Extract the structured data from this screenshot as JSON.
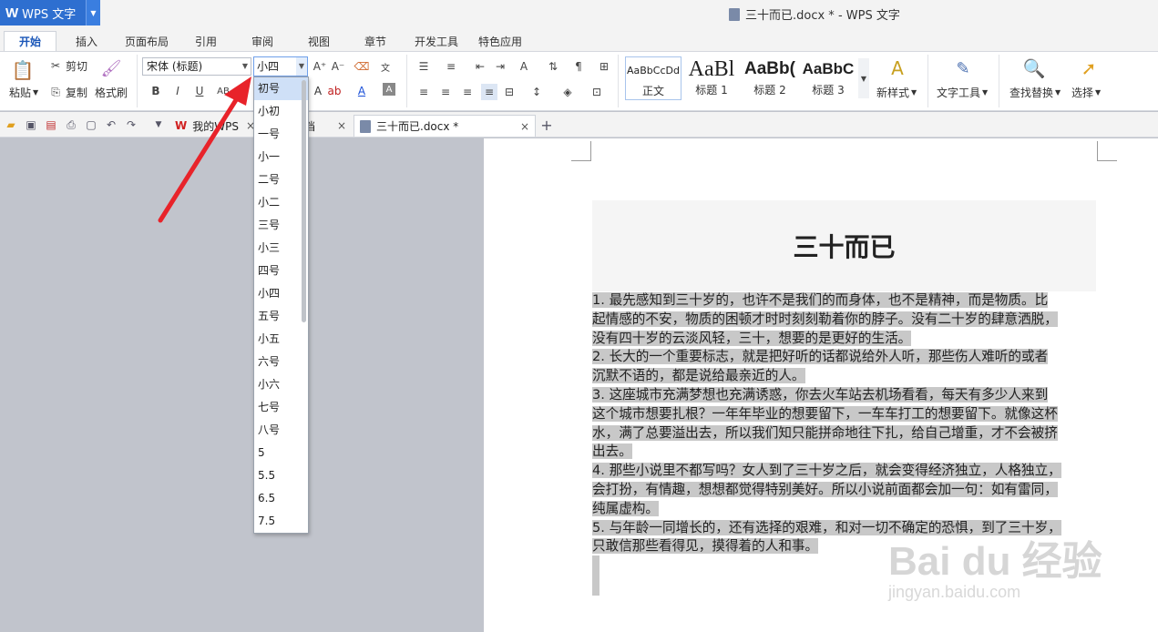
{
  "app": {
    "name": "WPS 文字",
    "window_title": "三十而已.docx * - WPS 文字"
  },
  "ribbon_tabs": [
    "开始",
    "插入",
    "页面布局",
    "引用",
    "审阅",
    "视图",
    "章节",
    "开发工具",
    "特色应用"
  ],
  "ribbon": {
    "paste": "粘贴",
    "cut": "剪切",
    "copy": "复制",
    "format_painter": "格式刷",
    "font_name": "宋体 (标题)",
    "font_size": "小四",
    "styles": [
      {
        "preview": "AaBbCcDd",
        "name": "正文"
      },
      {
        "preview": "AaBl",
        "name": "标题 1"
      },
      {
        "preview": "AaBb(",
        "name": "标题 2"
      },
      {
        "preview": "AaBbC",
        "name": "标题 3"
      }
    ],
    "new_style": "新样式",
    "text_tools": "文字工具",
    "find_replace": "查找替换",
    "select": "选择"
  },
  "doc_tabs": [
    {
      "label": "我的WPS"
    },
    {
      "label": "档"
    },
    {
      "label": "三十而已.docx *"
    }
  ],
  "font_size_options": [
    "初号",
    "小初",
    "一号",
    "小一",
    "二号",
    "小二",
    "三号",
    "小三",
    "四号",
    "小四",
    "五号",
    "小五",
    "六号",
    "小六",
    "七号",
    "八号",
    "5",
    "5.5",
    "6.5",
    "7.5"
  ],
  "font_size_highlighted": "初号",
  "document": {
    "title": "三十而已",
    "lines": [
      "1. 最先感知到三十岁的，也许不是我们的而身体，也不是精神，而是物质。比",
      "起情感的不安，物质的困顿才时时刻刻勒着你的脖子。没有二十岁的肆意洒脱，",
      "没有四十岁的云淡风轻，三十，想要的是更好的生活。",
      "2. 长大的一个重要标志，就是把好听的话都说给外人听，那些伤人难听的或者",
      "沉默不语的，都是说给最亲近的人。",
      "3. 这座城市充满梦想也充满诱惑，你去火车站去机场看看，每天有多少人来到",
      "这个城市想要扎根？一年年毕业的想要留下，一车车打工的想要留下。就像这杯",
      "水，满了总要溢出去，所以我们知只能拼命地往下扎，给自己增重，才不会被挤",
      "出去。",
      "4. 那些小说里不都写吗？女人到了三十岁之后，就会变得经济独立，人格独立，",
      "会打扮，有情趣，想想都觉得特别美好。所以小说前面都会加一句：如有雷同，",
      "纯属虚构。",
      "5. 与年龄一同增长的，还有选择的艰难，和对一切不确定的恐惧，到了三十岁，",
      "只敢信那些看得见，摸得着的人和事。"
    ]
  },
  "watermark": {
    "main": "Bai du 经验",
    "sub": "jingyan.baidu.com"
  }
}
